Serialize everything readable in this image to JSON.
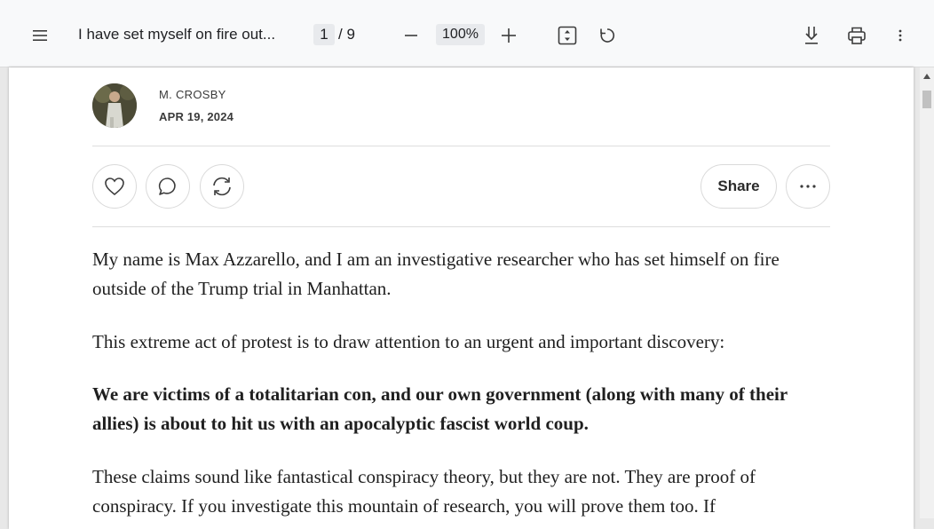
{
  "toolbar": {
    "menu_icon": "hamburger-menu-icon",
    "title": "I have set myself on fire out...",
    "current_page": "1",
    "page_separator": "/ 9",
    "zoom_level": "100%",
    "zoom_out_icon": "minus-icon",
    "zoom_in_icon": "plus-icon",
    "fit_icon": "fit-to-page-icon",
    "rotate_icon": "rotate-icon",
    "download_icon": "download-icon",
    "print_icon": "print-icon",
    "more_icon": "more-vertical-icon"
  },
  "article": {
    "author": "M. CROSBY",
    "date": "APR 19, 2024",
    "actions": {
      "like_icon": "heart-icon",
      "comment_icon": "comment-icon",
      "restack_icon": "restack-icon",
      "share_label": "Share",
      "more_icon": "more-horizontal-icon"
    },
    "paragraphs": [
      "My name is Max Azzarello, and I am an investigative researcher who has set himself on fire outside of the Trump trial in Manhattan.",
      "This extreme act of protest is to draw attention to an urgent and important discovery:",
      "We are victims of a totalitarian con, and our own government (along with many of their allies) is about to hit us with an apocalyptic fascist world coup.",
      "These claims sound like fantastical conspiracy theory, but they are not. They are proof of conspiracy. If you investigate this mountain of research, you will prove them too. If"
    ]
  }
}
